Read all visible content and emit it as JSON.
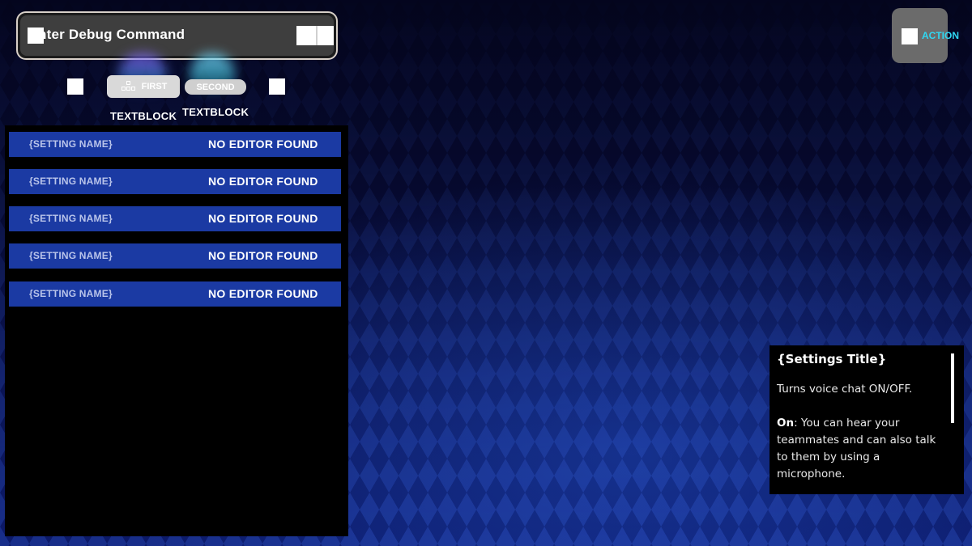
{
  "debug_bar": {
    "text": "nter Debug Command"
  },
  "tabs": [
    {
      "label": "FIRST",
      "icon": "grid-icon"
    },
    {
      "label": "SECOND"
    }
  ],
  "tab_textblocks": [
    "TEXTBLOCK",
    "TEXTBLOCK"
  ],
  "settings": [
    {
      "name": "{SETTING NAME}",
      "value": "NO EDITOR FOUND"
    },
    {
      "name": "{SETTING NAME}",
      "value": "NO EDITOR FOUND"
    },
    {
      "name": "{SETTING NAME}",
      "value": "NO EDITOR FOUND"
    },
    {
      "name": "{SETTING NAME}",
      "value": "NO EDITOR FOUND"
    },
    {
      "name": "{SETTING NAME}",
      "value": "NO EDITOR FOUND"
    }
  ],
  "action": {
    "label": "ACTION"
  },
  "description": {
    "title": "{Settings Title}",
    "line1": "Turns voice chat ON/OFF.",
    "on_label": "On",
    "on_text": ": You can hear your teammates and can also talk to them by using a microphone."
  },
  "colors": {
    "row_background": "#1b3aa3",
    "action_accent": "#2fd7f2"
  }
}
